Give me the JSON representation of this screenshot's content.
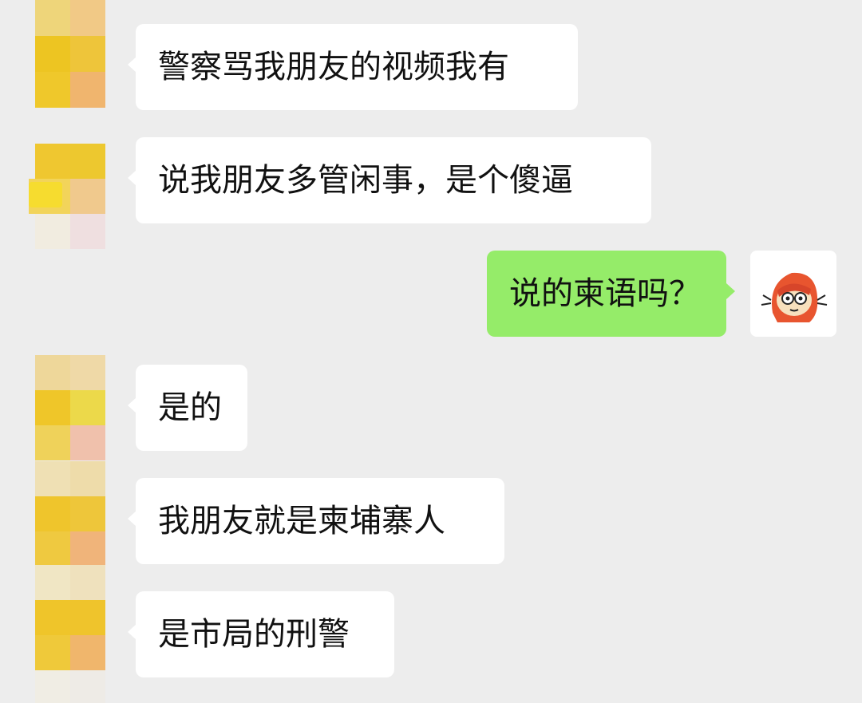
{
  "messages": [
    {
      "sender": "friend",
      "text": "警察骂我朋友的视频我有"
    },
    {
      "sender": "friend",
      "text": "说我朋友多管闲事，是个傻逼"
    },
    {
      "sender": "self",
      "text": "说的柬语吗？"
    },
    {
      "sender": "friend",
      "text": "是的"
    },
    {
      "sender": "friend",
      "text": "我朋友就是柬埔寨人"
    },
    {
      "sender": "friend",
      "text": "是市局的刑警"
    }
  ],
  "colors": {
    "background": "#ededed",
    "incoming_bubble": "#ffffff",
    "outgoing_bubble": "#95ec69",
    "text": "#111111"
  }
}
